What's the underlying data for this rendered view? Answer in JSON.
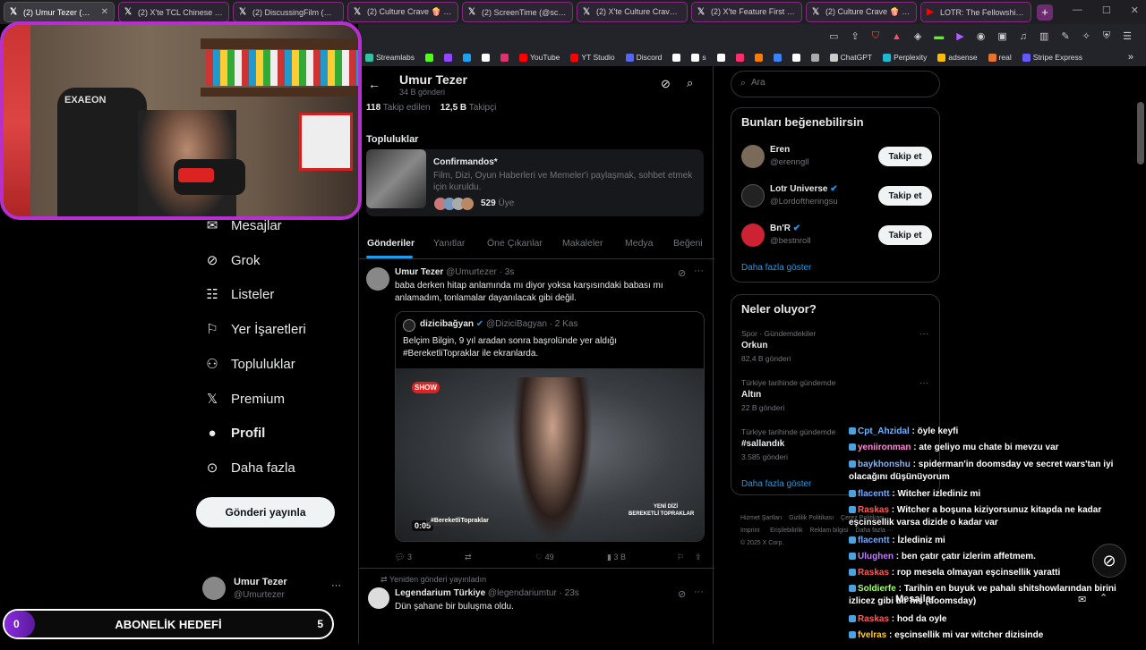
{
  "browser": {
    "tabs": [
      {
        "label": "(2) Umur Tezer (@Um",
        "icon": "x-logo-icon",
        "active": true
      },
      {
        "label": "(2) X'te TCL Chinese Theat",
        "icon": "x-logo-icon"
      },
      {
        "label": "(2) DiscussingFilm (@Disc",
        "icon": "x-logo-icon"
      },
      {
        "label": "(2) Culture Crave 🍿 (@C",
        "icon": "x-logo-icon"
      },
      {
        "label": "(2) ScreenTime (@screenti",
        "icon": "x-logo-icon"
      },
      {
        "label": "(2) X'te Culture Crave 🍿",
        "icon": "x-logo-icon"
      },
      {
        "label": "(2) X'te Feature First 🍿",
        "icon": "x-logo-icon"
      },
      {
        "label": "(2) Culture Crave 🍿 (@C",
        "icon": "x-logo-icon"
      },
      {
        "label": "LOTR: The Fellowship of T",
        "icon": "youtube-icon"
      }
    ],
    "new_tab": "+",
    "bookmarks": [
      {
        "label": "Streamlabs",
        "color": "#31c3a2"
      },
      {
        "label": "",
        "color": "#53fc18"
      },
      {
        "label": "",
        "color": "#9146ff"
      },
      {
        "label": "",
        "color": "#1da1f2"
      },
      {
        "label": "",
        "color": "#ffffff"
      },
      {
        "label": "",
        "color": "#e1306c"
      },
      {
        "label": "YouTube",
        "color": "#ff0000"
      },
      {
        "label": "YT Studio",
        "color": "#ff0000"
      },
      {
        "label": "Discord",
        "color": "#5865f2"
      },
      {
        "label": "",
        "color": "#ffffff"
      },
      {
        "label": "s",
        "color": "#ffffff"
      },
      {
        "label": "",
        "color": "#ffffff"
      },
      {
        "label": "",
        "color": "#ff2d6f"
      },
      {
        "label": "",
        "color": "#ff7a00"
      },
      {
        "label": "",
        "color": "#3b82f6"
      },
      {
        "label": "",
        "color": "#ffffff"
      },
      {
        "label": "",
        "color": "#aaaaaa"
      },
      {
        "label": "ChatGPT",
        "color": "#cccccc"
      },
      {
        "label": "Perplexity",
        "color": "#20b8cd"
      },
      {
        "label": "adsense",
        "color": "#fbbc04"
      },
      {
        "label": "real",
        "color": "#e8732a"
      },
      {
        "label": "Stripe Express",
        "color": "#635bff"
      }
    ]
  },
  "goal": {
    "left": "0",
    "title": "ABONELİK HEDEFİ",
    "right": "5"
  },
  "profile": {
    "name": "Umur Tezer",
    "posts": "34 B gönderi",
    "following_count": "118",
    "following_label": "Takip edilen",
    "followers_count": "12,5 B",
    "followers_label": "Takipçi",
    "communities_title": "Topluluklar",
    "community": {
      "name": "Confirmandos*",
      "desc": "Film, Dizi, Oyun Haberleri ve Memeler'i paylaşmak, sohbet etmek için kuruldu.",
      "members": "529",
      "members_label": "Üye"
    },
    "tabs": [
      "Gönderiler",
      "Yanıtlar",
      "Öne Çıkanlar",
      "Makaleler",
      "Medya",
      "Beğeni"
    ]
  },
  "tweet1": {
    "name": "Umur Tezer",
    "handle": "@Umurtezer · 3s",
    "text": "baba derken hitap anlamında mı diyor yoksa karşısındaki babası mı anlamadım, tonlamalar dayanılacak gibi değil.",
    "quote": {
      "name": "dizicibağyan",
      "handle": "@DiziciBagyan · 2 Kas",
      "text": "Belçim Bilgin, 9 yıl aradan sonra başrolünde yer aldığı #BereketliTopraklar ile ekranlarda.",
      "duration": "0:05",
      "video_tag": "#BereketliTopraklar",
      "video_brand": "BEREKETLİ TOPRAKLAR",
      "video_sub": "YENİ DİZİ",
      "channel": "SHOW"
    },
    "stats": {
      "replies": "3",
      "retweets": "",
      "likes": "49",
      "views": "3 B"
    }
  },
  "tweet2": {
    "repost_label": "Yeniden gönderi yayınladın",
    "name": "Legendarium Türkiye",
    "handle": "@legendariumtur · 23s",
    "text": "Dün şahane bir buluşma oldu."
  },
  "sidenav": {
    "items": [
      "Mesajlar",
      "Grok",
      "Listeler",
      "Yer İşaretleri",
      "Topluluklar",
      "Premium",
      "Profil",
      "Daha fazla"
    ],
    "post_button": "Gönderi yayınla",
    "account_name": "Umur Tezer",
    "account_handle": "@Umurtezer",
    "more": "···"
  },
  "search": {
    "placeholder": "Ara"
  },
  "suggest": {
    "title": "Bunları beğenebilirsin",
    "users": [
      {
        "name": "Eren",
        "handle": "@erenngll",
        "verified": false
      },
      {
        "name": "Lotr Universe",
        "handle": "@Lordoftheringsu",
        "verified": true
      },
      {
        "name": "Bn'R",
        "handle": "@bestnroll",
        "verified": true
      }
    ],
    "follow": "Takip et",
    "more": "Daha fazla göster"
  },
  "trends": {
    "title": "Neler oluyor?",
    "items": [
      {
        "context": "Spor · Gündemdekiler",
        "name": "Orkun",
        "count": "82,4 B gönderi"
      },
      {
        "context": "Türkiye tarihinde gündemde",
        "name": "Altın",
        "count": "22 B gönderi"
      },
      {
        "context": "Türkiye tarihinde gündemde",
        "name": "#sallandık",
        "count": "3.585 gönderi"
      }
    ],
    "more": "Daha fazla göster"
  },
  "footer": [
    "Hizmet Şartları",
    "Gizlilik Politikası",
    "Çerez Politikası",
    "Imprint",
    "Erişilebilirlik",
    "Reklam bilgisi",
    "Daha fazla ···",
    "© 2025 X Corp."
  ],
  "messages_label": "Mesajlar",
  "chat": [
    {
      "user": "Cpt_Ahzidal",
      "color": "#6fb6ff",
      "msg": "öyle keyfi"
    },
    {
      "user": "yeniironman",
      "color": "#ff8ad8",
      "msg": "ate geliyo mu chate bi mevzu var"
    },
    {
      "user": "baykhonshu",
      "color": "#7fb4ff",
      "msg": "spiderman'in doomsday ve secret wars'tan iyi olacağını düşünüyorum"
    },
    {
      "user": "flacentt",
      "color": "#6fa8ff",
      "msg": "Witcher izlediniz mi"
    },
    {
      "user": "Raskas",
      "color": "#ff5a5a",
      "msg": "Witcher a boşuna kiziyorsunuz kitapda ne kadar eşcinsellik varsa dizide o kadar var"
    },
    {
      "user": "flacentt",
      "color": "#6fa8ff",
      "msg": "İzlediniz mi"
    },
    {
      "user": "Ulughen",
      "color": "#c07aff",
      "msg": "ben çatır çatır izlerim affetmem."
    },
    {
      "user": "Raskas",
      "color": "#ff5a5a",
      "msg": "rop mesela olmayan eşcinsellik yaratti"
    },
    {
      "user": "Soldierfe",
      "color": "#a0ff70",
      "msg": "Tarihin en buyuk ve pahalı shitshowlarından birini izlicez gibi bir his (doomsday)"
    },
    {
      "user": "Raskas",
      "color": "#ff5a5a",
      "msg": "hod da oyle"
    },
    {
      "user": "fvelras",
      "color": "#ffcc33",
      "msg": "eşcinsellik mi var witcher dizisinde"
    }
  ]
}
